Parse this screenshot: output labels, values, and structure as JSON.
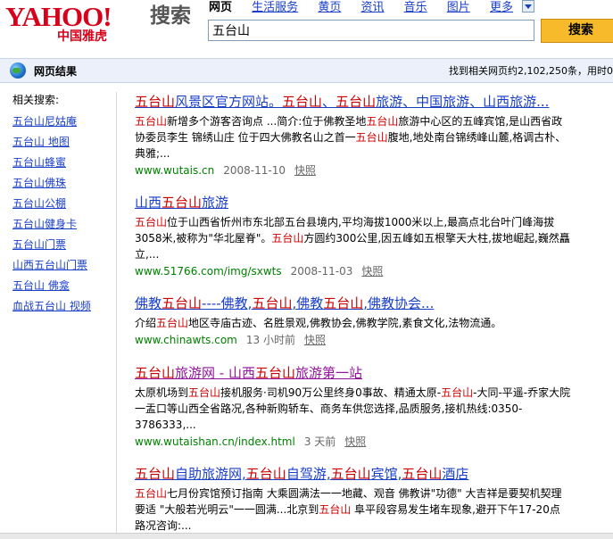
{
  "header": {
    "logo_yahoo": "YAHOO!",
    "logo_cn": "中国雅虎",
    "logo_search": "搜索",
    "nav": [
      "网页",
      "生活服务",
      "黄页",
      "资讯",
      "音乐",
      "图片",
      "更多"
    ],
    "query": "五台山",
    "search_button": "搜索"
  },
  "bar": {
    "title": "网页结果",
    "count": "找到相关网页约2,102,250条，用时0"
  },
  "sidebar": {
    "title": "相关搜索:",
    "items": [
      "五台山尼姑庵",
      "五台山 地图",
      "五台山蜂蜜",
      "五台山佛珠",
      "五台山公棚",
      "五台山健身卡",
      "五台山门票",
      "山西五台山门票",
      "五台山 佛龛",
      "血战五台山 视频"
    ]
  },
  "results": [
    {
      "title": "五台山风景区官方网站。五台山、五台山旅游、中国旅游、山西旅游...",
      "snippet": "五台山新增多个游客咨询点 ...简介:位于佛教圣地五台山旅游中心区的五峰宾馆,是山西省政协委员李生 锦绣山庄 位于四大佛教名山之首一五台山腹地,地处南台锦绣峰山麓,格调古朴、典雅;...",
      "url": "www.wutais.cn",
      "date": "2008-11-10",
      "cache": "快照"
    },
    {
      "title": "山西五台山旅游",
      "snippet": "五台山位于山西省忻州市东北部五台县境内,平均海拔1000米以上,最高点北台叶门峰海拔3058米,被称为\"华北屋脊\"。五台山方圆约300公里,因五峰如五根擎天大柱,拔地崛起,巍然矗立,...",
      "url": "www.51766.com/img/sxwts",
      "date": "2008-11-03",
      "cache": "快照"
    },
    {
      "title": "佛教五台山----佛教,五台山,佛教五台山,佛教协会...",
      "snippet": "介绍五台山地区寺庙古迹、名胜景观,佛教协会,佛教学院,素食文化,法物流通。",
      "url": "www.chinawts.com",
      "date": "13 小时前",
      "cache": "快照"
    },
    {
      "title": "五台山旅游网 - 山西五台山旅游第一站",
      "snippet": "太原机场到五台山接机服务·司机90万公里终身0事故、精通太原-五台山-大同-平遥-乔家大院一盂口等山西全省路况,各种新购轿车、商务车供您选择,品质服务,接机热线:0350-3786333,...",
      "url": "www.wutaishan.cn/index.html",
      "date": "3 天前",
      "cache": "快照"
    },
    {
      "title": "五台山自助旅游网,五台山自驾游,五台山宾馆,五台山酒店",
      "snippet": "五台山七月份宾馆预订指南 大乘圆满法一一地藏、观音 佛教讲\"功德\" 大吉祥是要契机契理 要适 \"大般若光明云\"一一圆满...北京到五台山 阜平段容易发生堵车现象,避开下午17-20点 路况咨询:...",
      "url": "",
      "date": "",
      "cache": ""
    }
  ],
  "colors": {
    "brand_red": "#d6021b",
    "link_blue": "#1a3fc7",
    "visited_purple": "#93139e",
    "url_green": "#008000",
    "highlight_red": "#cc0000",
    "search_button": "#f6ba2a"
  },
  "icons": {
    "bar_icon": "globe-icon",
    "more_arrow": "chevron-down-icon"
  }
}
